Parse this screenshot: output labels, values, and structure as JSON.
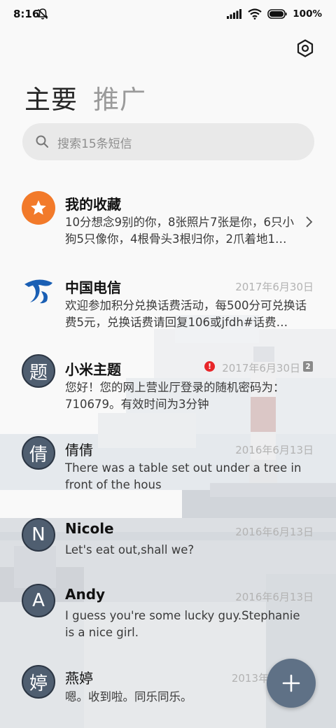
{
  "status_bar": {
    "time": "8:16",
    "battery": "100%",
    "icons": [
      "bell-off-icon",
      "signal-icon",
      "wifi-icon",
      "battery-icon"
    ]
  },
  "header": {
    "settings_icon": "settings-icon",
    "tabs": [
      {
        "label": "主要",
        "active": true
      },
      {
        "label": "推广",
        "active": false
      }
    ]
  },
  "search": {
    "placeholder": "搜索15条短信",
    "icon": "search-icon"
  },
  "conversations": [
    {
      "name": "我的收藏",
      "avatar_icon": "star-icon",
      "avatar_color": "#f27a2a",
      "date": "",
      "preview": "10分想念9别的你，8张照片7张是你，6只小狗5只像你，4根骨头3根归你，2爪着地1…",
      "has_chevron": true
    },
    {
      "name": "中国电信",
      "avatar_icon": "china-telecom-logo",
      "date": "2017年6月30日",
      "preview": "欢迎参加积分兑换话费活动，每500分可兑换话费5元，兑换话费请回复106或jfdh#话费…"
    },
    {
      "name": "小米主题",
      "avatar_text": "题",
      "date": "2017年6月30日",
      "error_icon": "error-icon",
      "error_mark": "!",
      "sim_badge": "2",
      "preview": "您好！您的网上营业厅登录的随机密码为：710679。有效时间为3分钟"
    },
    {
      "name": "倩倩",
      "avatar_text": "倩",
      "date": "2016年6月13日",
      "preview": "There was a table set out under a tree in front of the hous"
    },
    {
      "name": "Nicole",
      "avatar_text": "N",
      "date": "2016年6月13日",
      "preview": "Let's eat out,shall we?"
    },
    {
      "name": "Andy",
      "avatar_text": "A",
      "date": "2016年6月13日",
      "preview": "I guess you're some lucky guy.Stephanie is a nice girl."
    },
    {
      "name": "燕婷",
      "avatar_text": "婷",
      "date": "2013年",
      "preview": "嗯。收到啦。同乐同乐。"
    }
  ],
  "fab": {
    "icon": "plus-icon"
  },
  "colors": {
    "avatar_slate": "#4f5e70",
    "avatar_orange": "#f27a2a",
    "telecom_blue": "#1a5fb4",
    "error_red": "#e8262a",
    "fab": "#5f7186"
  }
}
